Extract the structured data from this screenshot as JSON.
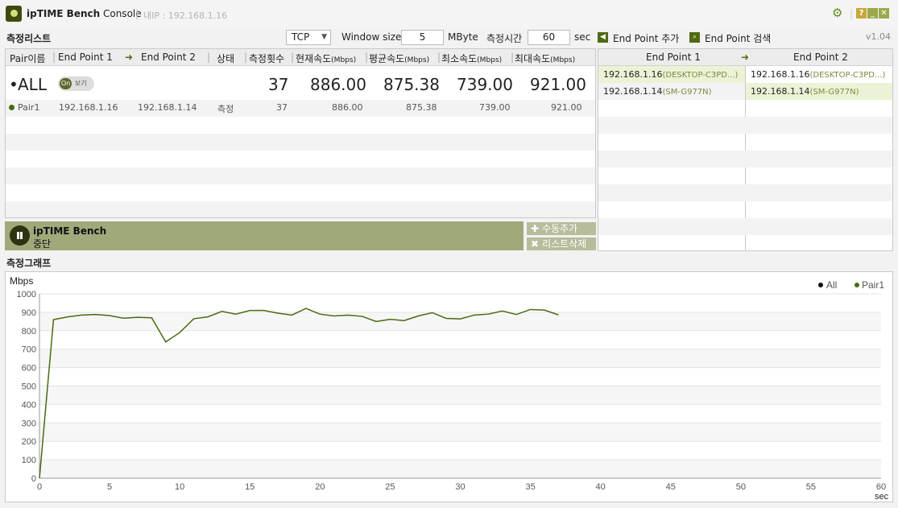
{
  "app": {
    "title_bold": "ipTIME Bench",
    "title_rest": "Console",
    "ip_label": "내IP : 192.168.1.16",
    "version": "v1.04"
  },
  "toolbar": {
    "list_title": "측정리스트",
    "protocol": "TCP",
    "window_size_label": "Window size",
    "window_size_value": "5",
    "window_size_unit": "MByte",
    "duration_label": "측정시간",
    "duration_value": "60",
    "duration_unit": "sec",
    "add_endpoint": "End Point 추가",
    "search_endpoint": "End Point 검색"
  },
  "list": {
    "headers": {
      "pair": "Pair이름",
      "ep1": "End Point 1",
      "ep2": "End Point 2",
      "status": "상태",
      "count": "측정횟수",
      "current": "현재속도",
      "average": "평균속도",
      "min": "최소속도",
      "max": "최대속도",
      "unit": "(Mbps)"
    },
    "all_row": {
      "name": "ALL",
      "toggle_on": "On",
      "toggle_label": "보기",
      "count": "37",
      "current": "886.00",
      "average": "875.38",
      "min": "739.00",
      "max": "921.00"
    },
    "rows": [
      {
        "name": "Pair1",
        "ep1": "192.168.1.16",
        "ep2": "192.168.1.14",
        "status": "측정",
        "count": "37",
        "current": "886.00",
        "average": "875.38",
        "min": "739.00",
        "max": "921.00"
      }
    ]
  },
  "bench": {
    "name": "ipTIME Bench",
    "status": "중단",
    "add_manual": "수동추가",
    "delete_list": "리스트삭제"
  },
  "endpoints": {
    "header_ep1": "End Point 1",
    "header_ep2": "End Point 2",
    "rows": [
      {
        "ep1_ip": "192.168.1.16",
        "ep1_host": "(DESKTOP-C3PD...)",
        "ep2_ip": "192.168.1.16",
        "ep2_host": "(DESKTOP-C3PD...)"
      },
      {
        "ep1_ip": "192.168.1.14",
        "ep1_host": "(SM-G977N)",
        "ep2_ip": "192.168.1.14",
        "ep2_host": "(SM-G977N)"
      }
    ]
  },
  "graph": {
    "title": "측정그래프"
  },
  "colors": {
    "series_all": "#111111",
    "series_pair1": "#4a6b12",
    "accent": "#9fa97a"
  },
  "chart_data": {
    "type": "line",
    "ylabel": "Mbps",
    "xlabel": "sec",
    "ylim": [
      0,
      1000
    ],
    "xlim": [
      0,
      60
    ],
    "yticks": [
      0,
      100,
      200,
      300,
      400,
      500,
      600,
      700,
      800,
      900,
      1000
    ],
    "xticks": [
      0,
      5,
      10,
      15,
      20,
      25,
      30,
      35,
      40,
      45,
      50,
      55,
      60
    ],
    "legend": "top-right",
    "grid": true,
    "series": [
      {
        "name": "All",
        "values": []
      },
      {
        "name": "Pair1",
        "x": [
          0,
          1,
          2,
          3,
          4,
          5,
          6,
          7,
          8,
          9,
          10,
          11,
          12,
          13,
          14,
          15,
          16,
          17,
          18,
          19,
          20,
          21,
          22,
          23,
          24,
          25,
          26,
          27,
          28,
          29,
          30,
          31,
          32,
          33,
          34,
          35,
          36,
          37
        ],
        "values": [
          0,
          860,
          875,
          885,
          888,
          882,
          868,
          873,
          870,
          739,
          790,
          865,
          875,
          905,
          890,
          910,
          910,
          895,
          885,
          921,
          890,
          880,
          885,
          878,
          850,
          862,
          855,
          880,
          898,
          867,
          864,
          885,
          890,
          907,
          888,
          915,
          912,
          886
        ]
      }
    ]
  }
}
